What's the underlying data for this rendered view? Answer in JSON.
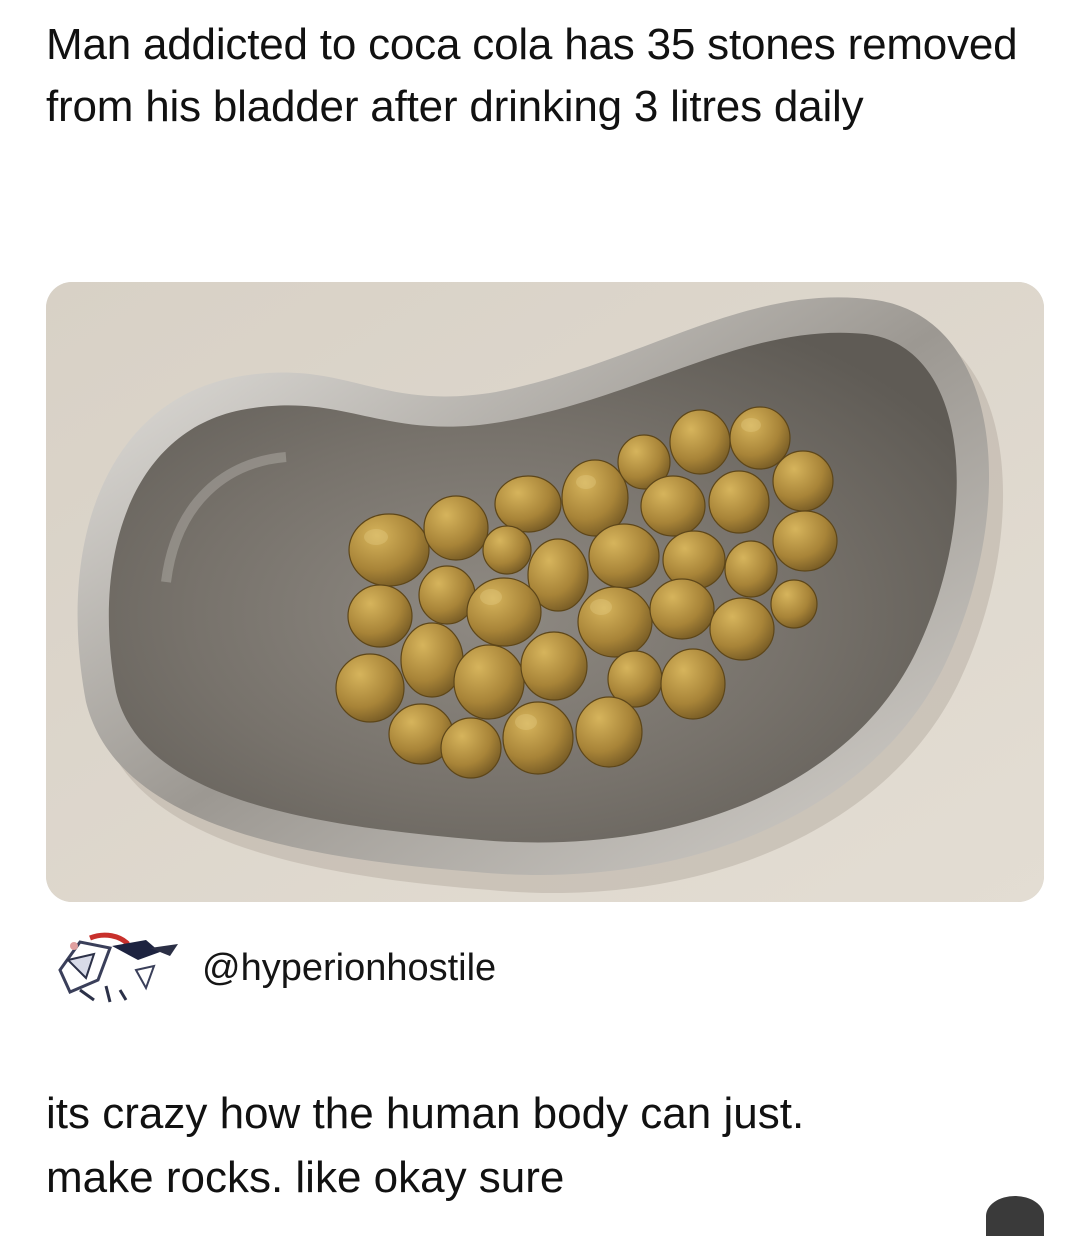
{
  "post": {
    "headline": "Man addicted to coca cola has 35 stones removed from his bladder after drinking 3 litres daily",
    "image_alt": "kidney-shaped steel dish holding bladder stones"
  },
  "reply": {
    "handle": "@hyperionhostile",
    "line1": "its crazy how the human body can just.",
    "line2": "make rocks. like okay sure"
  },
  "colors": {
    "text": "#111111",
    "background": "#ffffff",
    "stone": "#b8923e",
    "steel": "#a8a49d",
    "surface": "#d9d3c9"
  }
}
